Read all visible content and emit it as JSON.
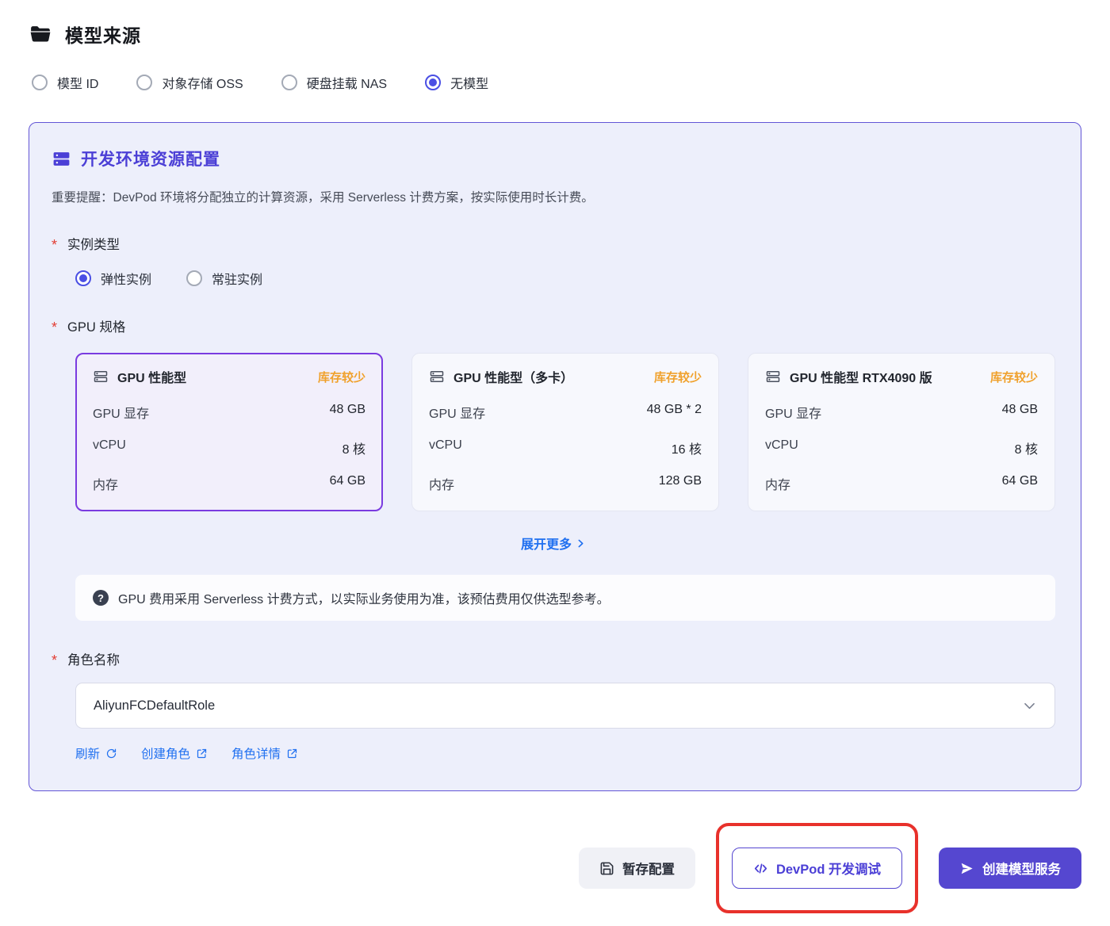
{
  "colors": {
    "accent_purple": "#5547d0",
    "panel_title_purple": "#4b3fd6",
    "panel_border": "#6356d6",
    "panel_bg": "#edeffb",
    "selected_card_border": "#7a3be0",
    "link_blue": "#2070f0",
    "badge_orange": "#f0a12c",
    "annotation_red": "#e8312b",
    "radio_checked": "#4a4fe4"
  },
  "page": {
    "title": "模型来源"
  },
  "model_source": {
    "options": [
      {
        "label": "模型 ID",
        "selected": false
      },
      {
        "label": "对象存储 OSS",
        "selected": false
      },
      {
        "label": "硬盘挂载 NAS",
        "selected": false
      },
      {
        "label": "无模型",
        "selected": true
      }
    ]
  },
  "dev_env": {
    "title": "开发环境资源配置",
    "notice": "重要提醒：DevPod 环境将分配独立的计算资源，采用 Serverless 计费方案，按实际使用时长计费。",
    "instance_type": {
      "label": "实例类型",
      "options": [
        {
          "label": "弹性实例",
          "selected": true
        },
        {
          "label": "常驻实例",
          "selected": false
        }
      ]
    },
    "gpu_spec": {
      "label": "GPU 规格",
      "cards": [
        {
          "title": "GPU 性能型",
          "badge": "库存较少",
          "selected": true,
          "rows": [
            {
              "label": "GPU 显存",
              "value": "48 GB"
            },
            {
              "label": "vCPU",
              "value": "8 核"
            },
            {
              "label": "内存",
              "value": "64 GB"
            }
          ]
        },
        {
          "title": "GPU 性能型（多卡）",
          "badge": "库存较少",
          "selected": false,
          "rows": [
            {
              "label": "GPU 显存",
              "value": "48 GB * 2"
            },
            {
              "label": "vCPU",
              "value": "16 核"
            },
            {
              "label": "内存",
              "value": "128 GB"
            }
          ]
        },
        {
          "title": "GPU 性能型 RTX4090 版",
          "badge": "库存较少",
          "selected": false,
          "rows": [
            {
              "label": "GPU 显存",
              "value": "48 GB"
            },
            {
              "label": "vCPU",
              "value": "8 核"
            },
            {
              "label": "内存",
              "value": "64 GB"
            }
          ]
        }
      ],
      "expand_more": "展开更多"
    },
    "fee_notice": "GPU 费用采用 Serverless 计费方式，以实际业务使用为准，该预估费用仅供选型参考。",
    "role": {
      "label": "角色名称",
      "selected_value": "AliyunFCDefaultRole",
      "links": [
        {
          "label": "刷新"
        },
        {
          "label": "创建角色"
        },
        {
          "label": "角色详情"
        }
      ]
    }
  },
  "footer": {
    "save_draft": "暂存配置",
    "devpod": "DevPod 开发调试",
    "create": "创建模型服务"
  }
}
